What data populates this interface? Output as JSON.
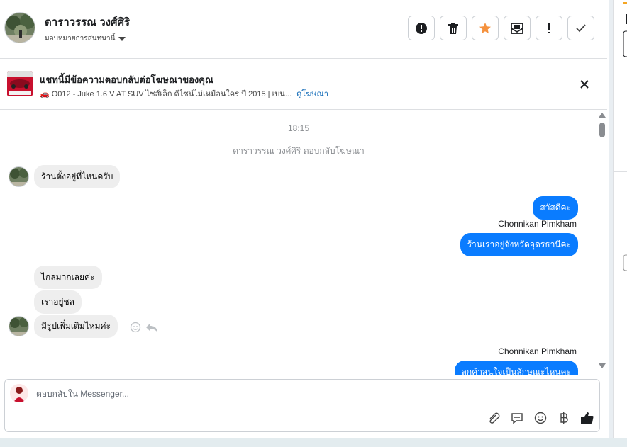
{
  "header": {
    "contact_name": "ดาราวรรณ วงศ์ศิริ",
    "assign_label": "มอบหมายการสนทนานี้",
    "actions": [
      {
        "icon": "alert-circle-icon",
        "name": "mark-spam-button"
      },
      {
        "icon": "trash-icon",
        "name": "delete-button"
      },
      {
        "icon": "star-icon",
        "name": "star-button"
      },
      {
        "icon": "envelope-icon",
        "name": "mark-unread-button"
      },
      {
        "icon": "exclamation-icon",
        "name": "follow-up-button"
      },
      {
        "icon": "check-icon",
        "name": "mark-done-button"
      }
    ]
  },
  "ad": {
    "title": "แชทนี้มีข้อความตอบกลับต่อโฆษณาของคุณ",
    "summary": "🚗 O012 - Juke 1.6 V AT SUV ไซส์เล็ก ดีไซน์ไม่เหมือนใคร ปี 2015 | เบน...",
    "link": "ดูโฆษณา"
  },
  "chat": {
    "timestamp": "18:15",
    "system_note": "ดาราวรรณ วงศ์ศิริ ตอบกลับโฆษณา",
    "messages": {
      "in1": "ร้านตั้งอยู่ที่ไหนครับ",
      "out1": "สวัสดีคะ",
      "sender1": "Chonnikan Pimkham",
      "out2": "ร้านเราอยู่จังหวัดอุดรธานีคะ",
      "in2": "ไกลมากเลยค่ะ",
      "in3": "เราอยู่ชล",
      "in4": "มีรูปเพิ่มเติมไหมค่ะ",
      "sender2": "Chonnikan Pimkham",
      "out3": "ลูกค้าสนใจเป็นลักษณะไหนคะ"
    }
  },
  "composer": {
    "placeholder": "ตอบกลับใน Messenger...",
    "tools": [
      "paperclip-icon",
      "comment-icon",
      "smiley-icon",
      "baht-icon",
      "thumbs-up-icon"
    ]
  },
  "colors": {
    "outgoing_bubble": "#0a7cff",
    "incoming_bubble": "#eeeeee",
    "star": "#f5923e",
    "link": "#0a66b5"
  }
}
